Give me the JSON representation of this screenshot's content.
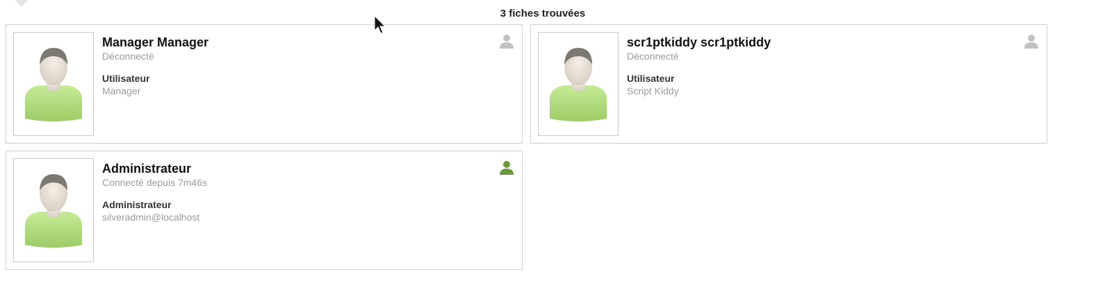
{
  "results": {
    "count_label": "3 fiches trouvées"
  },
  "cards": [
    {
      "name": "Manager Manager",
      "status": "Déconnecté",
      "role": "Utilisateur",
      "detail": "Manager",
      "presence": "offline",
      "presence_icon": "user-offline-icon",
      "presence_color": "#c2c2c2"
    },
    {
      "name": "scr1ptkiddy scr1ptkiddy",
      "status": "Déconnecté",
      "role": "Utilisateur",
      "detail": "Script Kiddy",
      "presence": "offline",
      "presence_icon": "user-offline-icon",
      "presence_color": "#c2c2c2"
    },
    {
      "name": "Administrateur",
      "status": "Connecté depuis 7m46s",
      "role": "Administrateur",
      "detail": "silveradmin@localhost",
      "presence": "online",
      "presence_icon": "user-online-icon",
      "presence_color": "#6b9a3a"
    }
  ],
  "colors": {
    "avatar_shirt": "#a9d872",
    "avatar_skin": "#ebe3d9",
    "avatar_hair": "#7a7770"
  }
}
